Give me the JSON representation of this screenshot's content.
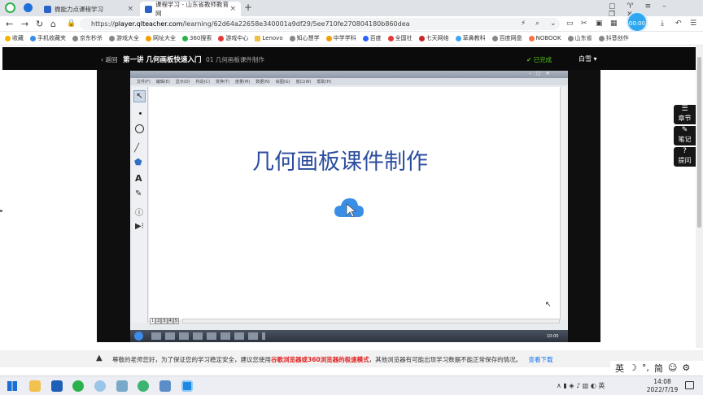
{
  "tabs": [
    {
      "title": "微能力点课程学习",
      "active": false
    },
    {
      "title": "课程学习 - 山东省教师教育网",
      "active": true
    }
  ],
  "address": {
    "url_scheme": "https://",
    "url_host": "player.qlteacher.com",
    "url_path": "/learning/62d64a22658e340001a9df29/5ee710fe270804180b860dea",
    "timer_badge": "00:00"
  },
  "bookmarks": [
    "收藏",
    "手机收藏夹",
    "京东秒杀",
    "游戏大全",
    "网址大全",
    "360搜索",
    "游戏中心",
    "Lenovo",
    "知心慧学",
    "中学学科",
    "百度",
    "全国社",
    "七天网络",
    "草鼻教科",
    "百度网盘",
    "NOBOOK",
    "山东省",
    "抖音创作"
  ],
  "player": {
    "back_label": "返回",
    "lecture_title": "第一讲 几何画板快速入门",
    "lesson_title": "01 几何画板课件制作",
    "status": "已完成",
    "user": "白雪"
  },
  "video": {
    "slide_title": "几何画板课件制作",
    "menu_items": [
      "文件(F)",
      "编辑(E)",
      "显示(D)",
      "构造(C)",
      "变换(T)",
      "度量(M)",
      "数据(N)",
      "绘图(G)",
      "窗口(W)",
      "帮助(H)"
    ],
    "page_tabs": [
      "1",
      "2",
      "3",
      "4",
      "5"
    ],
    "clock": "10:00"
  },
  "side_panel": [
    {
      "label": "章节",
      "icon": "menu-icon"
    },
    {
      "label": "笔记",
      "icon": "pen-icon"
    },
    {
      "label": "提问",
      "icon": "question-icon"
    }
  ],
  "notice": {
    "prefix": "尊敬的老师您好，为了保证您的学习稳定安全，建议您使用",
    "highlight": "谷歌浏览器或360浏览器的极速模式",
    "suffix": "，其他浏览器有可能出现学习数据不能正常保存的情况。",
    "link": "查看下载"
  },
  "ime": {
    "lang": "英",
    "mode": "简"
  },
  "taskbar": {
    "lang": "英",
    "time": "14:08",
    "date": "2022/7/19"
  },
  "colors": {
    "accent_green": "#52c41a",
    "notice_red": "#e02020",
    "link_blue": "#1a73e8",
    "cloud_blue": "#3a8ee6"
  }
}
